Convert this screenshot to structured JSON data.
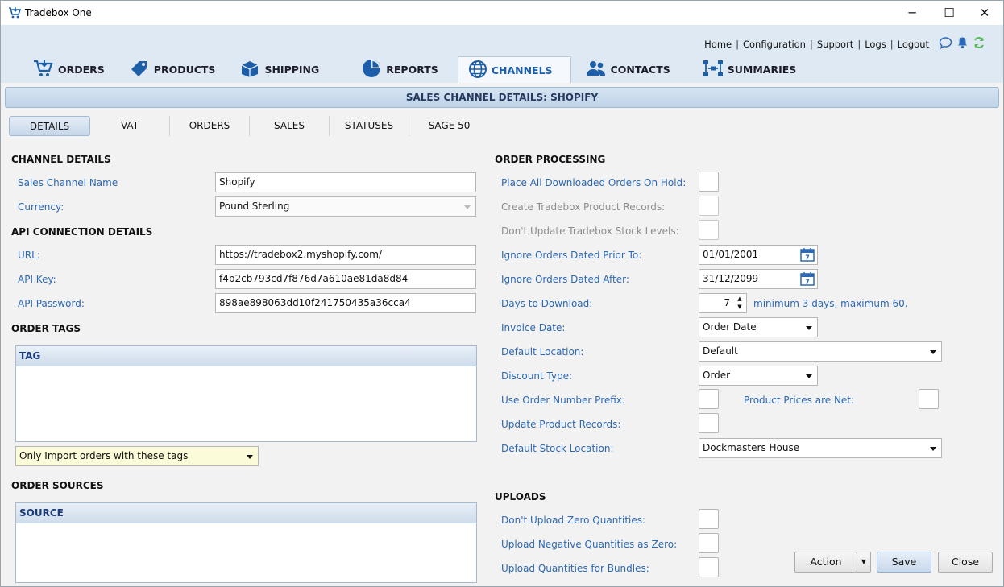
{
  "window": {
    "title": "Tradebox One",
    "minimize": "─",
    "maximize": "☐",
    "close": "✕"
  },
  "top_links": [
    "Home",
    "Configuration",
    "Support",
    "Logs",
    "Logout"
  ],
  "nav_tabs": [
    {
      "label": "ORDERS",
      "icon": "cart-icon"
    },
    {
      "label": "PRODUCTS",
      "icon": "tag-icon"
    },
    {
      "label": "SHIPPING",
      "icon": "box-icon"
    },
    {
      "label": "REPORTS",
      "icon": "pie-chart-icon"
    },
    {
      "label": "CHANNELS",
      "icon": "globe-icon",
      "active": true
    },
    {
      "label": "CONTACTS",
      "icon": "people-icon"
    },
    {
      "label": "SUMMARIES",
      "icon": "hierarchy-icon"
    }
  ],
  "page_title": "SALES CHANNEL DETAILS: SHOPIFY",
  "sub_tabs": [
    "DETAILS",
    "VAT",
    "ORDERS",
    "SALES",
    "STATUSES",
    "SAGE 50"
  ],
  "channel_details": {
    "heading": "CHANNEL DETAILS",
    "name_label": "Sales Channel Name",
    "name_value": "Shopify",
    "currency_label": "Currency:",
    "currency_value": "Pound Sterling"
  },
  "api": {
    "heading": "API CONNECTION DETAILS",
    "url_label": "URL:",
    "url_value": "https://tradebox2.myshopify.com/",
    "key_label": "API Key:",
    "key_value": "f4b2cb793cd7f876d7a610ae81da8d84",
    "password_label": "API Password:",
    "password_value": "898ae898063dd10f241750435a36cca4"
  },
  "order_tags": {
    "heading": "ORDER TAGS",
    "column": "TAG",
    "filter_value": "Only Import orders with these tags"
  },
  "order_sources": {
    "heading": "ORDER SOURCES",
    "column": "SOURCE"
  },
  "order_processing": {
    "heading": "ORDER PROCESSING",
    "place_on_hold": "Place All Downloaded Orders On Hold:",
    "create_product_records": "Create Tradebox Product Records:",
    "dont_update_stock": "Don't Update Tradebox Stock Levels:",
    "ignore_prior_label": "Ignore Orders Dated Prior To:",
    "ignore_prior_value": "01/01/2001",
    "ignore_after_label": "Ignore Orders Dated After:",
    "ignore_after_value": "31/12/2099",
    "days_label": "Days to Download:",
    "days_value": "7",
    "days_hint": "minimum 3 days, maximum 60.",
    "invoice_date_label": "Invoice Date:",
    "invoice_date_value": "Order Date",
    "default_location_label": "Default Location:",
    "default_location_value": "Default",
    "discount_type_label": "Discount Type:",
    "discount_type_value": "Order",
    "order_prefix_label": "Use Order Number Prefix:",
    "prices_net_label": "Product Prices are Net:",
    "update_product_label": "Update Product Records:",
    "stock_location_label": "Default Stock Location:",
    "stock_location_value": "Dockmasters House"
  },
  "uploads": {
    "heading": "UPLOADS",
    "zero_qty": "Don't Upload Zero Quantities:",
    "negative_qty": "Upload Negative Quantities as Zero:",
    "bundles_qty": "Upload Quantities for Bundles:"
  },
  "buttons": {
    "action": "Action",
    "save": "Save",
    "close": "Close"
  },
  "colors": {
    "accent": "#2c68b4",
    "nav_background": "#dfe9f4",
    "status_green": "#5cb85c"
  }
}
